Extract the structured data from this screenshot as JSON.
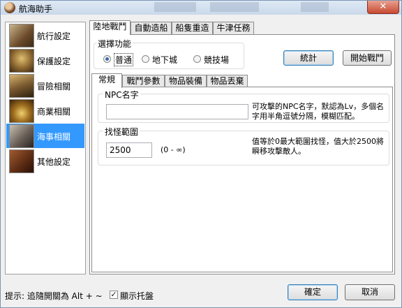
{
  "window": {
    "title": "航海助手",
    "close_glyph": "✕"
  },
  "sidebar": {
    "items": [
      {
        "label": "航行設定",
        "icon": "ship-thumbnail-icon",
        "color": "#8b6a3c"
      },
      {
        "label": "保護設定",
        "icon": "coins-thumbnail-icon",
        "color": "#7a5a2a"
      },
      {
        "label": "冒險相關",
        "icon": "adventure-thumbnail-icon",
        "color": "#6b5a3a"
      },
      {
        "label": "商業相關",
        "icon": "treasure-thumbnail-icon",
        "color": "#5a4020"
      },
      {
        "label": "海事相關",
        "icon": "battle-thumbnail-icon",
        "color": "#7a6a5a"
      },
      {
        "label": "其他設定",
        "icon": "book-thumbnail-icon",
        "color": "#6a3a1a"
      }
    ],
    "selected_index": 4
  },
  "top_tabs": [
    "陸地戰鬥",
    "自動造船",
    "船隻重造",
    "牛津任務"
  ],
  "mode_group": {
    "title": "選擇功能",
    "options": [
      "普通",
      "地下城",
      "競技場"
    ],
    "selected": "普通"
  },
  "buttons": {
    "stats": "統計",
    "start_battle": "開始戰鬥",
    "ok": "確定",
    "cancel": "取消"
  },
  "inner_tabs": [
    "常規",
    "戰鬥參數",
    "物品裝備",
    "物品丟棄"
  ],
  "npc_group": {
    "title": "NPC名字",
    "value": "",
    "hint": "可攻擊的NPC名字，默認為Lv，多個名字用半角逗號分隔，模糊匹配。"
  },
  "range_group": {
    "title": "找怪範圍",
    "value": "2500",
    "range": "(0 - ∞)",
    "hint": "值等於0最大範圍找怪，值大於2500將瞬移攻擊敵人。"
  },
  "footer": {
    "hint": "提示: 追隨開關為 Alt + ~",
    "tray_label": "顯示托盤",
    "tray_checked": true,
    "check_glyph": "✓"
  },
  "colors": {
    "accent": "#3399ff",
    "titlebar": "#c9d8ea",
    "close": "#c74a32"
  }
}
